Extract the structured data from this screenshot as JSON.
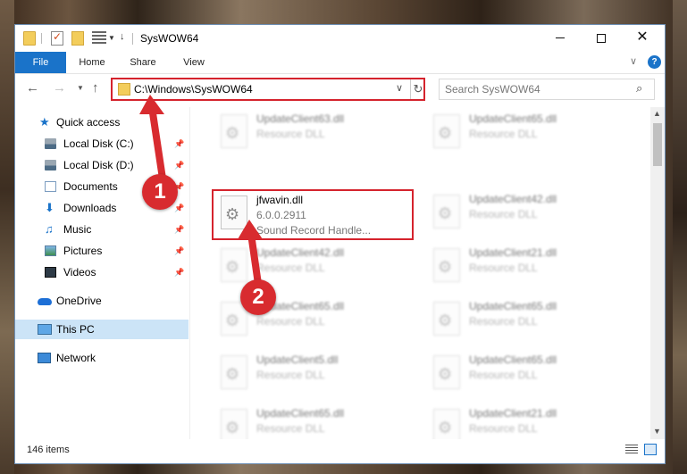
{
  "window": {
    "title": "SysWOW64",
    "qa_arrow": "↓",
    "min_symbol": "",
    "close_symbol": "✕"
  },
  "ribbon": {
    "tabs": [
      "File",
      "Home",
      "Share",
      "View"
    ],
    "help": "?"
  },
  "address": {
    "path": "C:\\Windows\\SysWOW64",
    "refresh": "↻"
  },
  "search": {
    "placeholder": "Search SysWOW64",
    "icon_glyph": "⌕"
  },
  "nav": {
    "items": [
      {
        "label": "Quick access",
        "icon": "star-icon",
        "pinned": false
      },
      {
        "label": "Local Disk (C:)",
        "icon": "disk-icon",
        "pinned": true
      },
      {
        "label": "Local Disk (D:)",
        "icon": "disk-icon",
        "pinned": true
      },
      {
        "label": "Documents",
        "icon": "documents-icon",
        "pinned": true
      },
      {
        "label": "Downloads",
        "icon": "downloads-icon",
        "pinned": true
      },
      {
        "label": "Music",
        "icon": "music-icon",
        "pinned": true
      },
      {
        "label": "Pictures",
        "icon": "pictures-icon",
        "pinned": true
      },
      {
        "label": "Videos",
        "icon": "videos-icon",
        "pinned": true
      },
      {
        "label": "OneDrive",
        "icon": "onedrive-icon",
        "pinned": false
      },
      {
        "label": "This PC",
        "icon": "pc-icon",
        "pinned": false,
        "selected": true
      },
      {
        "label": "Network",
        "icon": "network-icon",
        "pinned": false
      }
    ]
  },
  "files": {
    "left": [
      {
        "name": "UpdateClient63.dll",
        "type": "Resource DLL"
      },
      {
        "name": "jfwavin.dll",
        "version": "6.0.0.2911",
        "description": "Sound Record Handle..."
      },
      {
        "name": "UpdateClient42.dll",
        "type": "Resource DLL"
      },
      {
        "name": "UpdateClient65.dll",
        "type": "Resource DLL"
      },
      {
        "name": "UpdateClient5.dll",
        "type": "Resource DLL"
      },
      {
        "name": "UpdateClient65.dll",
        "type": "Resource DLL"
      }
    ],
    "right": [
      {
        "name": "UpdateClient65.dll",
        "type": "Resource DLL"
      },
      {
        "name": "UpdateClient42.dll",
        "type": "Resource DLL"
      },
      {
        "name": "UpdateClient21.dll",
        "type": "Resource DLL"
      },
      {
        "name": "UpdateClient65.dll",
        "type": "Resource DLL"
      },
      {
        "name": "UpdateClient65.dll",
        "type": "Resource DLL"
      },
      {
        "name": "UpdateClient21.dll",
        "type": "Resource DLL"
      }
    ]
  },
  "status": {
    "item_count": "146 items"
  },
  "annotations": {
    "step1": "1",
    "step2": "2",
    "color": "#d82b2f"
  }
}
